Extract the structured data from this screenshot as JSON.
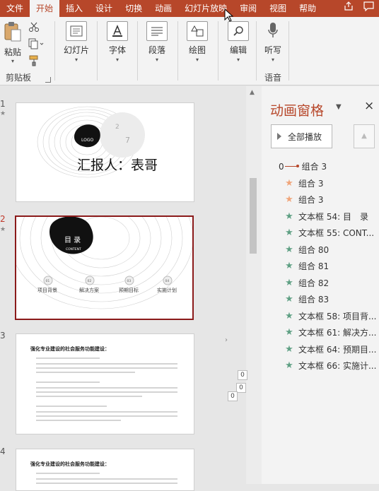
{
  "tabs": [
    "文件",
    "开始",
    "插入",
    "设计",
    "切换",
    "动画",
    "幻灯片放映",
    "审阅",
    "视图",
    "帮助"
  ],
  "ribbon": {
    "paste": "粘贴",
    "clipboard_group": "剪贴板",
    "slides": "幻灯片",
    "font": "字体",
    "paragraph": "段落",
    "drawing": "绘图",
    "editing": "编辑",
    "dictate": "听写",
    "voice_group": "语音"
  },
  "thumbnails": {
    "numbers": [
      "1",
      "2",
      "3",
      "4"
    ],
    "star": "★",
    "slide1": {
      "logo": "LOGO",
      "reporter": "汇报人：表哥",
      "deco_numbers": [
        "2",
        "7"
      ]
    },
    "slide2": {
      "title": "目 录",
      "subtitle": "CONTENT",
      "items": [
        {
          "num": "01",
          "label": "项目背景"
        },
        {
          "num": "02",
          "label": "解决方案"
        },
        {
          "num": "03",
          "label": "预期目标"
        },
        {
          "num": "04",
          "label": "实施计划"
        }
      ]
    },
    "slide3": {
      "heading": "强化专业建设的社会服务功能建设："
    },
    "slide4": {
      "heading": "强化专业建设的社会服务功能建设："
    }
  },
  "animation_pane": {
    "title": "动画窗格",
    "close": "×",
    "play_all": "全部播放",
    "items": [
      {
        "prefix": "0",
        "label": "组合 3",
        "icon": "motion-path"
      },
      {
        "label": "组合 3",
        "icon": "star-orange"
      },
      {
        "label": "组合 3",
        "icon": "star-orange"
      },
      {
        "label": "文本框 54: 目　录",
        "icon": "star-green"
      },
      {
        "label": "文本框 55: CONT...",
        "icon": "star-green"
      },
      {
        "label": "组合 80",
        "icon": "star-green"
      },
      {
        "label": "组合 81",
        "icon": "star-green"
      },
      {
        "label": "组合 82",
        "icon": "star-green"
      },
      {
        "label": "组合 83",
        "icon": "star-green"
      },
      {
        "label": "文本框 58: 项目背...",
        "icon": "star-green"
      },
      {
        "label": "文本框 61: 解决方...",
        "icon": "star-green"
      },
      {
        "label": "文本框 64: 预期目...",
        "icon": "star-green"
      },
      {
        "label": "文本框 66: 实施计...",
        "icon": "star-green"
      }
    ]
  },
  "edge_boxes": [
    "0",
    "0",
    "0"
  ],
  "colors": {
    "accent": "#b7472a",
    "selected_border": "#8b1a1a",
    "star_green": "#5fa084",
    "star_orange": "#f0a57a"
  }
}
